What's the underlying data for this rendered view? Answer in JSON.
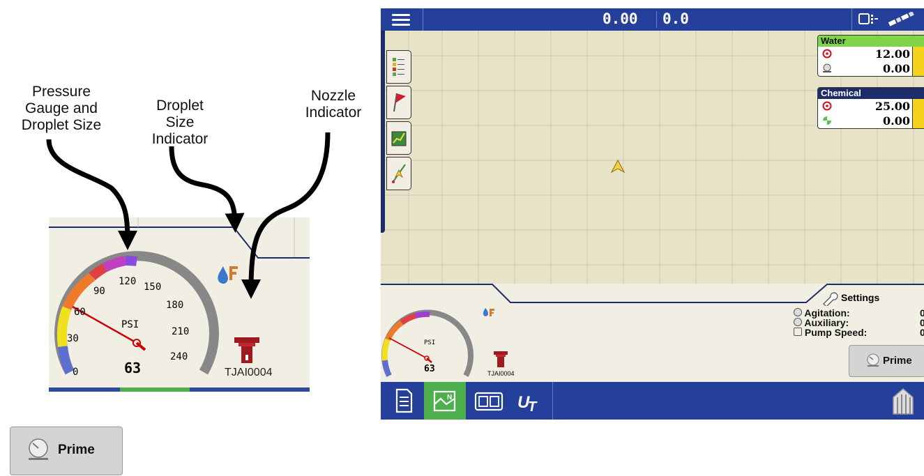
{
  "callouts": {
    "pressure_gauge": [
      "Pressure",
      "Gauge  and",
      "Droplet Size"
    ],
    "droplet_size": [
      "Droplet",
      "Size",
      "Indicator"
    ],
    "nozzle": [
      "Nozzle",
      "Indicator"
    ]
  },
  "zoom": {
    "gauge_unit": "PSI",
    "gauge_value": "63",
    "gauge_ticks": [
      "0",
      "30",
      "60",
      "90",
      "120",
      "150",
      "180",
      "210",
      "240"
    ],
    "nozzle_label": "TJAI0004"
  },
  "topbar": {
    "speed": "0.00",
    "heading": "0.0"
  },
  "products": [
    {
      "name": "Water",
      "header_color": "#7fd44a",
      "header_text_color": "#111111",
      "target": "12.00",
      "actual": "0.00"
    },
    {
      "name": "Chemical",
      "header_color": "#1c2d6a",
      "header_text_color": "#ffffff",
      "target": "25.00",
      "actual": "0.00"
    }
  ],
  "bottom": {
    "gauge_unit": "PSI",
    "gauge_value": "63",
    "nozzle_label": "TJAI0004",
    "settings_label": "Settings",
    "agitation_label": "Agitation:",
    "auxiliary_label": "Auxiliary:",
    "pump_speed_label": "Pump Speed:",
    "agitation_value": "0",
    "auxiliary_value": "0",
    "pump_speed_value": "0",
    "prime_label": "Prime"
  },
  "prime_button": {
    "label": "Prime"
  },
  "colors": {
    "bar_blue": "#24409a",
    "nav_active_green": "#4db04d",
    "map_bg": "#e7e3c8",
    "panel_bg": "#f1efe4",
    "needle_red": "#cc0000",
    "nozzle_red": "#a01820",
    "droplet_blue": "#3a78c9",
    "droplet_F_orange": "#d9782b"
  },
  "icons": [
    "menu-icon",
    "display-toggle-icon",
    "gps-satellite-icon",
    "layers-legend-icon",
    "flag-icon",
    "chart-icon",
    "guidance-icon",
    "vehicle-arrow-icon",
    "target-rate-icon",
    "pressure-gauge-icon",
    "wrench-icon",
    "pump-icon",
    "document-icon",
    "map-view-icon",
    "split-view-icon",
    "ut-icon",
    "home-icon"
  ]
}
